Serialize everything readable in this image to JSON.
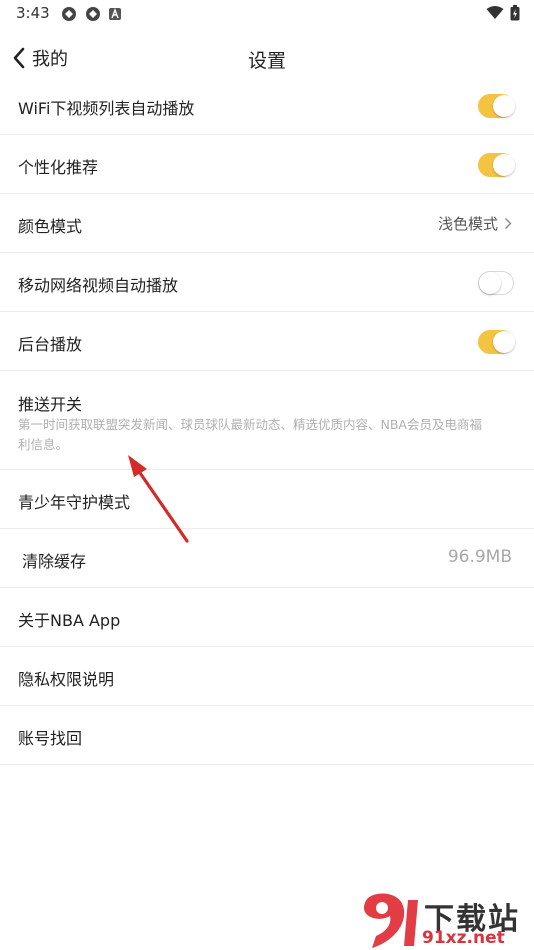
{
  "status_bar": {
    "time": "3:43"
  },
  "header": {
    "back_label": "我的",
    "title": "设置"
  },
  "settings": {
    "wifi_autoplay": {
      "label": "WiFi下视频列表自动播放",
      "enabled": true
    },
    "personalized": {
      "label": "个性化推荐",
      "enabled": true
    },
    "color_mode": {
      "label": "颜色模式",
      "value": "浅色模式"
    },
    "mobile_autoplay": {
      "label": "移动网络视频自动播放",
      "enabled": false
    },
    "background_play": {
      "label": "后台播放",
      "enabled": true
    },
    "push": {
      "label": "推送开关",
      "description": "第一时间获取联盟突发新闻、球员球队最新动态、精选优质内容、NBA会员及电商福利信息。"
    },
    "youth_mode": {
      "label": "青少年守护模式"
    },
    "clear_cache": {
      "label": "清除缓存",
      "value": "96.9MB"
    },
    "about": {
      "label": "关于NBA App"
    },
    "privacy": {
      "label": "隐私权限说明"
    },
    "account_recovery": {
      "label": "账号找回"
    }
  },
  "colors": {
    "toggle_on": "#f5c342",
    "annotation_arrow": "#d42a2a",
    "watermark_red": "#d9343c"
  },
  "watermark": {
    "line1": "下载站",
    "line2": "91xz.net"
  }
}
